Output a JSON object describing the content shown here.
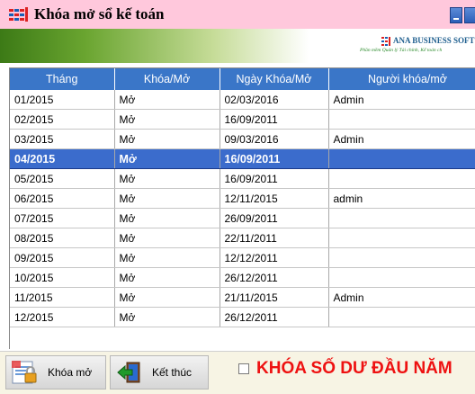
{
  "window": {
    "title": "Khóa mở sổ kế toán"
  },
  "banner": {
    "brand": "ANA BUSINESS SOFT",
    "slogan": "Phần mềm Quản lý Tài chính, Kế toán ch"
  },
  "table": {
    "columns": [
      "Tháng",
      "Khóa/Mở",
      "Ngày Khóa/Mở",
      "Người khóa/mở"
    ],
    "rows": [
      [
        "01/2015",
        "Mở",
        "02/03/2016",
        "Admin"
      ],
      [
        "02/2015",
        "Mở",
        "16/09/2011",
        ""
      ],
      [
        "03/2015",
        "Mở",
        "09/03/2016",
        "Admin"
      ],
      [
        "04/2015",
        "Mở",
        "16/09/2011",
        ""
      ],
      [
        "05/2015",
        "Mở",
        "16/09/2011",
        ""
      ],
      [
        "06/2015",
        "Mở",
        "12/11/2015",
        "admin"
      ],
      [
        "07/2015",
        "Mở",
        "26/09/2011",
        ""
      ],
      [
        "08/2015",
        "Mở",
        "22/11/2011",
        ""
      ],
      [
        "09/2015",
        "Mở",
        "12/12/2011",
        ""
      ],
      [
        "10/2015",
        "Mở",
        "26/12/2011",
        ""
      ],
      [
        "11/2015",
        "Mở",
        "21/11/2015",
        "Admin"
      ],
      [
        "12/2015",
        "Mở",
        "26/12/2011",
        ""
      ]
    ],
    "selected_row_index": 3
  },
  "buttons": {
    "lock_label": "Khóa mở",
    "exit_label": "Kết thúc"
  },
  "checkbox": {
    "label": "KHÓA SỐ DƯ ĐẦU NĂM",
    "checked": false
  },
  "icons": {
    "app": "ledger-grid-icon",
    "lock": "lock-document-icon",
    "exit": "exit-arrow-icon"
  },
  "colors": {
    "title_bar": "#ffc8dc",
    "header": "#3a76c8",
    "selected_row": "#3b6ccc",
    "accent_text": "#e11111"
  }
}
